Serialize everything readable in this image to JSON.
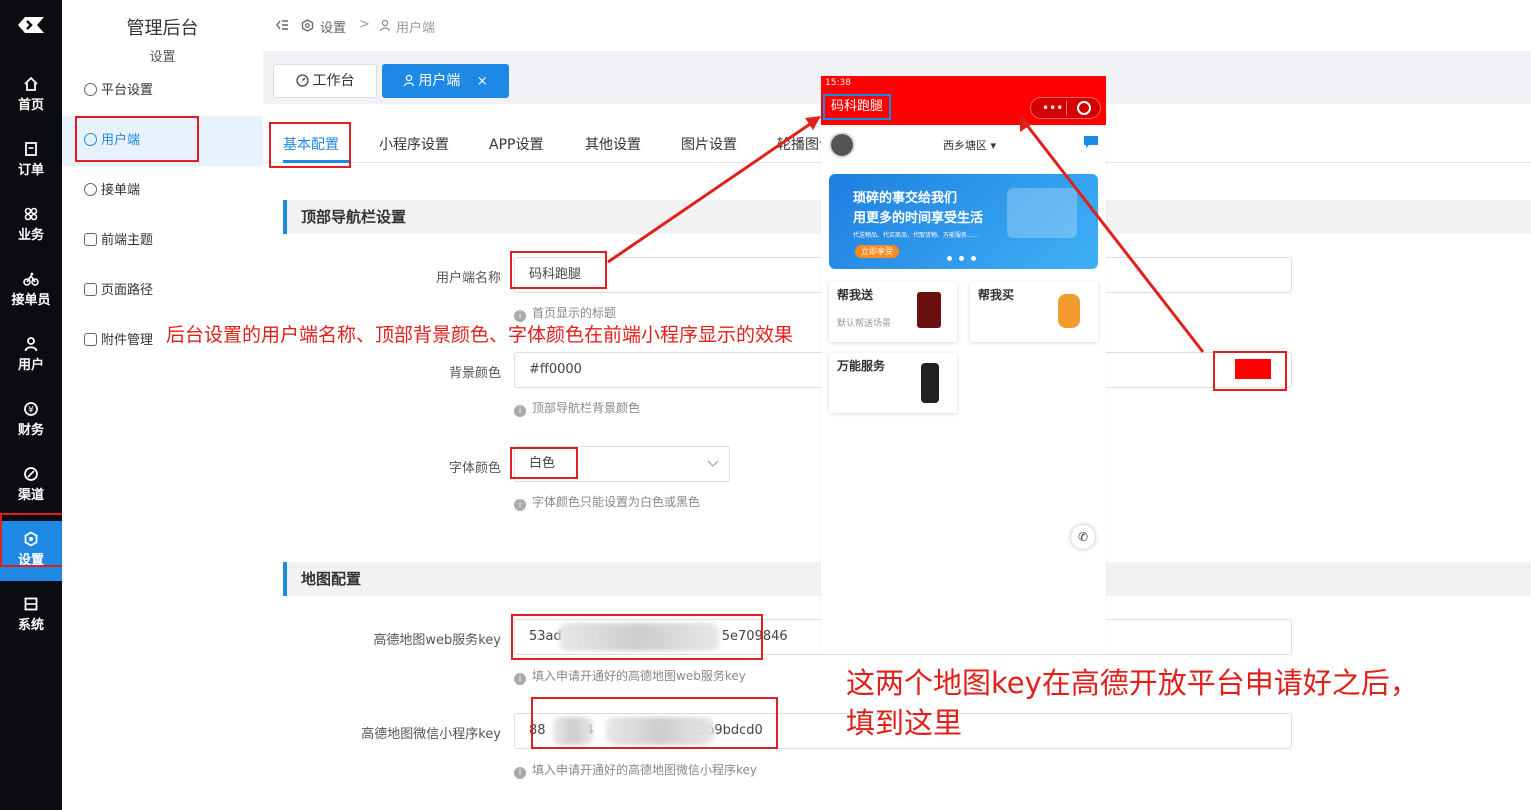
{
  "rail": {
    "items": [
      {
        "label": "首页",
        "icon": "home-icon"
      },
      {
        "label": "订单",
        "icon": "order-icon"
      },
      {
        "label": "业务",
        "icon": "business-icon"
      },
      {
        "label": "接单员",
        "icon": "rider-icon"
      },
      {
        "label": "用户",
        "icon": "user-icon"
      },
      {
        "label": "财务",
        "icon": "finance-icon"
      },
      {
        "label": "渠道",
        "icon": "channel-icon"
      },
      {
        "label": "设置",
        "icon": "settings-icon"
      },
      {
        "label": "系统",
        "icon": "system-icon"
      }
    ],
    "active": "设置"
  },
  "sidebar": {
    "title": "管理后台",
    "subtitle": "设置",
    "items": [
      {
        "label": "平台设置"
      },
      {
        "label": "用户端"
      },
      {
        "label": "接单端"
      },
      {
        "label": "前端主题"
      },
      {
        "label": "页面路径"
      },
      {
        "label": "附件管理"
      }
    ],
    "active": "用户端"
  },
  "breadcrumb": {
    "root": "设置",
    "sep": ">",
    "current": "用户端"
  },
  "page_tabs": [
    {
      "label": "工作台"
    },
    {
      "label": "用户端",
      "close": "×"
    }
  ],
  "content_tabs": [
    "基本配置",
    "小程序设置",
    "APP设置",
    "其他设置",
    "图片设置",
    "轮播图设置"
  ],
  "sections": {
    "nav": "顶部导航栏设置",
    "map": "地图配置"
  },
  "form": {
    "name_label": "用户端名称",
    "name_value": "码科跑腿",
    "name_hint": "首页显示的标题",
    "bg_label": "背景颜色",
    "bg_value": "#ff0000",
    "bg_hint": "顶部导航栏背景颜色",
    "font_label": "字体颜色",
    "font_value": "白色",
    "font_hint": "字体颜色只能设置为白色或黑色",
    "web_key_label": "高德地图web服务key",
    "web_key_prefix": "53ad",
    "web_key_suffix": "5e709846",
    "web_key_hint": "填入申请开通好的高德地图web服务key",
    "mini_key_label": "高德地图微信小程序key",
    "mini_key_prefix": "88",
    "mini_key_mid": "4",
    "mini_key_suffix": "3b9bdcd0",
    "mini_key_hint": "填入申请开通好的高德地图微信小程序key"
  },
  "phone": {
    "time": "15:38",
    "title": "码科跑腿",
    "location": "西乡塘区",
    "banner_line1": "琐碎的事交给我们",
    "banner_line2": "用更多的时间享受生活",
    "banner_small": "代送物品、代买商品、代取货物、万能服务......",
    "banner_btn": "立即享受",
    "card1_title": "帮我送",
    "card1_sub": "默认帮送场景",
    "card2_title": "帮我买",
    "card3_title": "万能服务",
    "nav_bg": "#ff0000"
  },
  "annotations": {
    "note1": "后台设置的用户端名称、顶部背景颜色、字体颜色在前端小程序显示的效果",
    "note2_line1": "这两个地图key在高德开放平台申请好之后，",
    "note2_line2": "填到这里"
  },
  "colors": {
    "accent": "#1e88e5",
    "annotation": "#e0201a",
    "rail_bg": "#0a0c10"
  }
}
